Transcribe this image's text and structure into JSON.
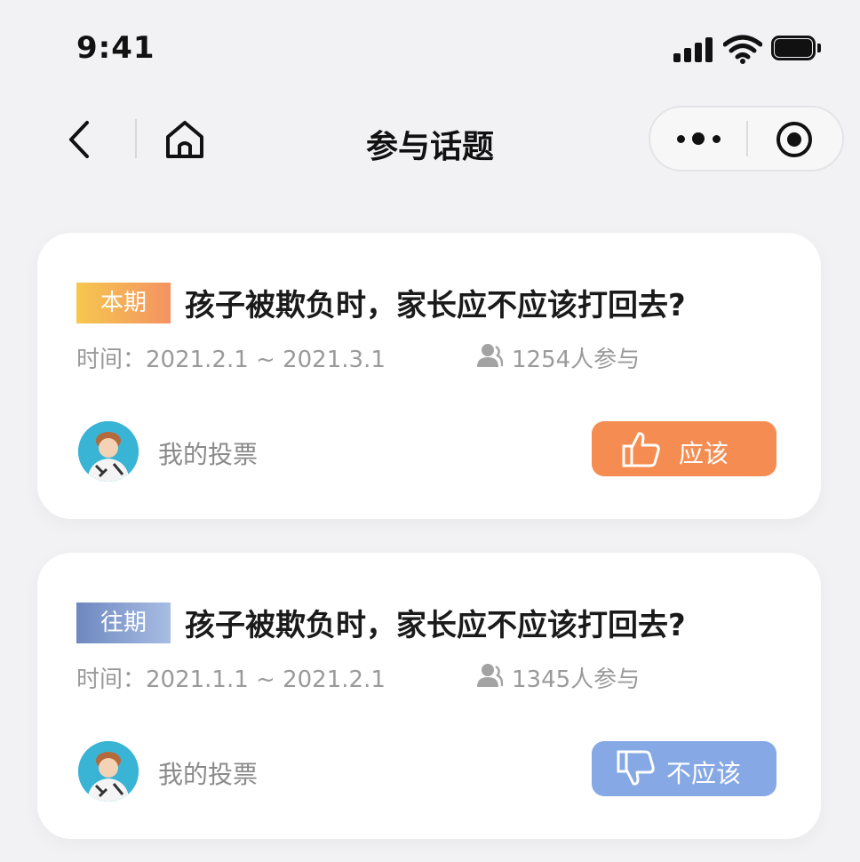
{
  "status_bar": {
    "time": "9:41"
  },
  "nav": {
    "title": "参与话题"
  },
  "topics": [
    {
      "tag": "本期",
      "title": "孩子被欺负时，家长应不应该打回去?",
      "time": "时间：2021.2.1 ~ 2021.3.1",
      "participants": "1254人参与",
      "my_vote_label": "我的投票",
      "vote_label": "应该",
      "vote_icon": "thumbs-up-icon",
      "tag_colors": [
        "#f6c74e",
        "#f39363"
      ],
      "vote_color": "#f58d52"
    },
    {
      "tag": "往期",
      "title": "孩子被欺负时，家长应不应该打回去?",
      "time": "时间：2021.1.1 ~ 2021.2.1",
      "participants": "1345人参与",
      "my_vote_label": "我的投票",
      "vote_label": "不应该",
      "vote_icon": "thumbs-down-icon",
      "tag_colors": [
        "#6e88c0",
        "#a8bde3"
      ],
      "vote_color": "#86a8e4"
    }
  ]
}
